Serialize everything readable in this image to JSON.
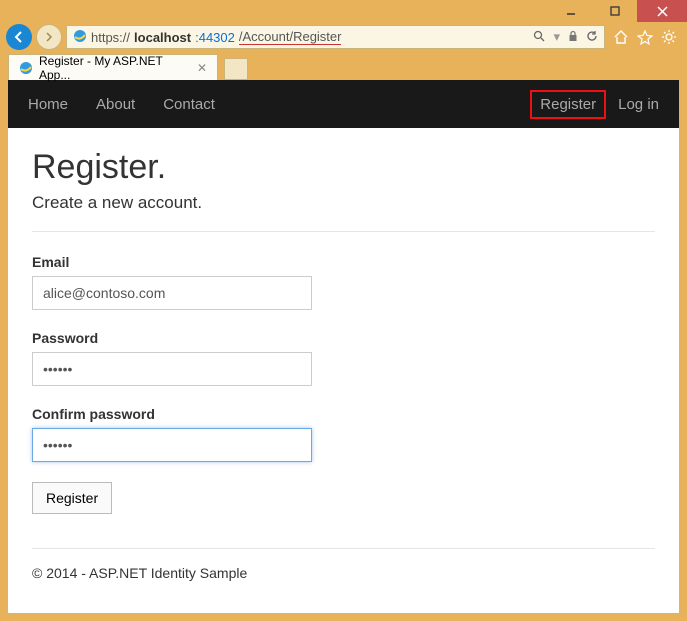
{
  "window": {
    "tab_title": "Register - My ASP.NET App..."
  },
  "address": {
    "protocol": "https://",
    "host": "localhost",
    "port": ":44302",
    "path": "/Account/Register"
  },
  "nav": {
    "home": "Home",
    "about": "About",
    "contact": "Contact",
    "register": "Register",
    "login": "Log in"
  },
  "page": {
    "heading": "Register.",
    "subtitle": "Create a new account.",
    "email_label": "Email",
    "email_value": "alice@contoso.com",
    "password_label": "Password",
    "password_value": "••••••",
    "confirm_label": "Confirm password",
    "confirm_value": "••••••",
    "submit_label": "Register",
    "footer": "© 2014 - ASP.NET Identity Sample"
  }
}
